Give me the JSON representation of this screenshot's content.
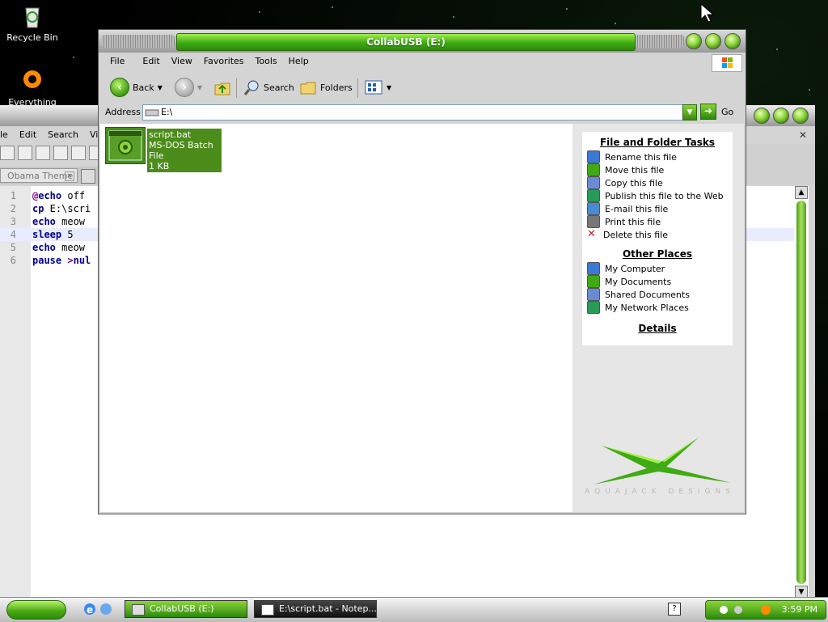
{
  "desktop": {
    "icons": [
      {
        "label": "Recycle Bin",
        "icon": "recycle-bin-icon"
      },
      {
        "label": "Everything",
        "icon": "everything-search-icon"
      }
    ]
  },
  "notepad": {
    "menu": [
      "le",
      "Edit",
      "Search",
      "View"
    ],
    "tab_label": "Obama Theme",
    "code_lines": [
      {
        "num": "1",
        "parts": [
          {
            "t": "@",
            "c": "op"
          },
          {
            "t": "echo",
            "c": "kw"
          },
          {
            "t": " off",
            "c": ""
          }
        ]
      },
      {
        "num": "2",
        "parts": [
          {
            "t": "cp",
            "c": "kw"
          },
          {
            "t": " E:\\scri",
            "c": ""
          }
        ]
      },
      {
        "num": "3",
        "parts": [
          {
            "t": "echo",
            "c": "kw"
          },
          {
            "t": " meow",
            "c": ""
          }
        ]
      },
      {
        "num": "4",
        "parts": [
          {
            "t": "sleep",
            "c": "kw"
          },
          {
            "t": " 5",
            "c": ""
          }
        ]
      },
      {
        "num": "5",
        "parts": [
          {
            "t": "echo",
            "c": "kw"
          },
          {
            "t": " meow",
            "c": ""
          }
        ]
      },
      {
        "num": "6",
        "parts": [
          {
            "t": "pause",
            "c": "kw"
          },
          {
            "t": " ",
            "c": ""
          },
          {
            "t": ">",
            "c": "op"
          },
          {
            "t": "nul",
            "c": "kw"
          }
        ]
      }
    ],
    "highlight_line": 4
  },
  "explorer": {
    "title": "CollabUSB (E:)",
    "menu": [
      "File",
      "Edit",
      "View",
      "Favorites",
      "Tools",
      "Help"
    ],
    "toolbar": {
      "back": "Back",
      "search": "Search",
      "folders": "Folders"
    },
    "address": {
      "label": "Address",
      "value": "E:\\",
      "go": "Go"
    },
    "file": {
      "name": "script.bat",
      "type": "MS-DOS Batch File",
      "size": "1 KB"
    },
    "tasks": {
      "file_folder_header": "File and Folder Tasks",
      "file_folder_items": [
        {
          "label": "Rename this file",
          "icon": "rename-icon"
        },
        {
          "label": "Move this file",
          "icon": "move-icon"
        },
        {
          "label": "Copy this file",
          "icon": "copy-icon"
        },
        {
          "label": "Publish this file to the Web",
          "icon": "publish-web-icon"
        },
        {
          "label": "E-mail this file",
          "icon": "email-icon"
        },
        {
          "label": "Print this file",
          "icon": "print-icon"
        },
        {
          "label": "Delete this file",
          "icon": "delete-icon"
        }
      ],
      "other_places_header": "Other Places",
      "other_places_items": [
        {
          "label": "My Computer",
          "icon": "my-computer-icon"
        },
        {
          "label": "My Documents",
          "icon": "my-documents-icon"
        },
        {
          "label": "Shared Documents",
          "icon": "shared-documents-icon"
        },
        {
          "label": "My Network Places",
          "icon": "network-places-icon"
        }
      ],
      "details_header": "Details"
    },
    "brand_text": "AQUAJACK DESIGNS"
  },
  "taskbar": {
    "tasks": [
      {
        "label": "CollabUSB (E:)",
        "active": true
      },
      {
        "label": "E:\\script.bat - Notep...",
        "active": false
      }
    ],
    "clock": "3:59 PM"
  },
  "colors": {
    "accent_green": "#3faa14",
    "highlight_green": "#4c8c1a"
  }
}
